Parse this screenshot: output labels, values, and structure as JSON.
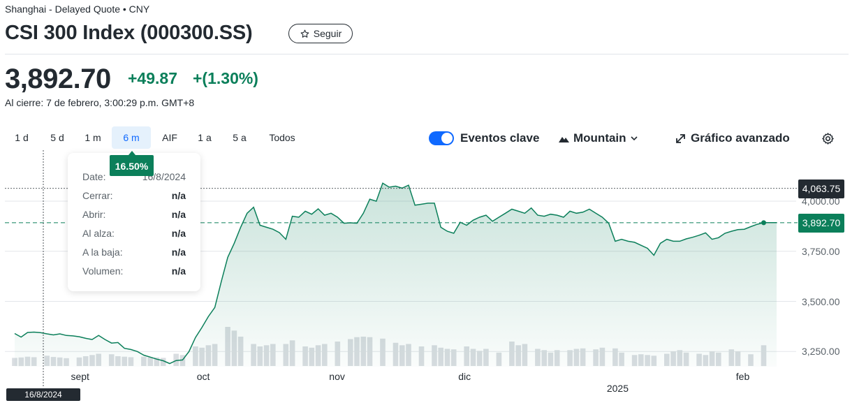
{
  "header": {
    "exchange_line": "Shanghai - Delayed Quote • CNY",
    "title": "CSI 300 Index (000300.SS)",
    "follow_label": "Seguir"
  },
  "quote": {
    "price": "3,892.70",
    "change": "+49.87",
    "change_percent": "+(1.30%)",
    "close_time": "Al cierre: 7 de febrero, 3:00:29 p.m. GMT+8"
  },
  "ranges": [
    {
      "label": "1 d",
      "active": false
    },
    {
      "label": "5 d",
      "active": false
    },
    {
      "label": "1 m",
      "active": false
    },
    {
      "label": "6 m",
      "active": true
    },
    {
      "label": "AIF",
      "active": false
    },
    {
      "label": "1 a",
      "active": false
    },
    {
      "label": "5 a",
      "active": false
    },
    {
      "label": "Todos",
      "active": false
    }
  ],
  "toolbar": {
    "events_label": "Eventos clave",
    "events_on": true,
    "chart_type_label": "Mountain",
    "advanced_label": "Gráfico avanzado"
  },
  "tooltip": {
    "badge": "16.50%",
    "rows": [
      {
        "label": "Date:",
        "value": "16/8/2024"
      },
      {
        "label": "Cerrar:",
        "value": "n/a"
      },
      {
        "label": "Abrir:",
        "value": "n/a"
      },
      {
        "label": "Al alza:",
        "value": "n/a"
      },
      {
        "label": "A la baja:",
        "value": "n/a"
      },
      {
        "label": "Volumen:",
        "value": "n/a"
      }
    ]
  },
  "crosshair_date": "16/8/2024",
  "colors": {
    "accent_green": "#0b7f5a",
    "tab_active_bg": "#e5f1fc",
    "tab_active_text": "#0f69ff",
    "hover_tag": "#232a31",
    "volume_bar": "#d9dde1"
  },
  "chart_data": {
    "type": "area",
    "y_ticks": [
      "3,250.00",
      "3,500.00",
      "3,750.00",
      "4,000.00"
    ],
    "y_tick_values": [
      3250,
      3500,
      3750,
      4000
    ],
    "ylim": [
      3150,
      4150
    ],
    "hover_level": {
      "label": "4,063.75",
      "value": 4063.75
    },
    "last_price": {
      "label": "3,892.70",
      "value": 3892.7
    },
    "x_labels": [
      {
        "label": "sept",
        "t": 10
      },
      {
        "label": "oct",
        "t": 29.5
      },
      {
        "label": "nov",
        "t": 50
      },
      {
        "label": "dic",
        "t": 70
      },
      {
        "label": "2025",
        "t": 93,
        "row": 2
      },
      {
        "label": "feb",
        "t": 113
      }
    ],
    "t_range": [
      0,
      118
    ],
    "x": [
      0,
      1,
      2,
      3,
      4,
      5,
      6,
      7,
      8,
      9,
      10,
      11,
      12,
      13,
      14,
      15,
      16,
      17,
      18,
      19,
      20,
      21,
      22,
      23,
      24,
      25,
      26,
      27,
      28,
      29,
      30,
      31,
      32,
      33,
      34,
      35,
      36,
      37,
      38,
      39,
      40,
      41,
      42,
      43,
      44,
      45,
      46,
      47,
      48,
      49,
      50,
      51,
      52,
      53,
      54,
      55,
      56,
      57,
      58,
      59,
      60,
      61,
      62,
      63,
      64,
      65,
      66,
      67,
      68,
      69,
      70,
      71,
      72,
      73,
      74,
      75,
      76,
      77,
      78,
      79,
      80,
      81,
      82,
      83,
      84,
      85,
      86,
      87,
      88,
      89,
      90,
      91,
      92,
      93,
      94,
      95,
      96,
      97,
      98,
      99,
      100,
      101,
      102,
      103,
      104,
      105,
      106,
      107,
      108,
      109,
      110,
      111,
      112,
      113,
      114,
      115,
      116,
      117,
      118
    ],
    "series": [
      {
        "values": [
          3340,
          3322,
          3345,
          3347,
          3344,
          3338,
          3333,
          3338,
          3330,
          3328,
          3324,
          3316,
          3310,
          3330,
          3310,
          3292,
          3295,
          3266,
          3260,
          3250,
          3232,
          3222,
          3212,
          3204,
          3190,
          3205,
          3208,
          3250,
          3320,
          3370,
          3425,
          3470,
          3600,
          3720,
          3790,
          3870,
          3940,
          3970,
          3880,
          3870,
          3860,
          3843,
          3810,
          3925,
          3920,
          3950,
          3935,
          3962,
          3930,
          3940,
          3920,
          3890,
          3892,
          3890,
          3940,
          4010,
          4000,
          4090,
          4070,
          4075,
          4065,
          4080,
          3980,
          3985,
          3990,
          3990,
          3870,
          3850,
          3840,
          3895,
          3880,
          3905,
          3920,
          3930,
          3900,
          3920,
          3940,
          3960,
          3950,
          3940,
          3966,
          3930,
          3925,
          3935,
          3930,
          3920,
          3950,
          3940,
          3945,
          3960,
          3940,
          3920,
          3890,
          3800,
          3810,
          3800,
          3795,
          3780,
          3765,
          3730,
          3790,
          3810,
          3800,
          3800,
          3812,
          3820,
          3830,
          3842,
          3810,
          3818,
          3840,
          3850,
          3858,
          3860,
          3873,
          3885,
          3892.7,
          3892.7,
          3892.7
        ],
        "volume_rel": [
          0.33,
          0.35,
          0.38,
          0.36,
          0.0,
          0.42,
          0.37,
          0.35,
          0.32,
          0.0,
          0.35,
          0.4,
          0.45,
          0.5,
          0.0,
          0.48,
          0.4,
          0.38,
          0.36,
          0.0,
          0.38,
          0.36,
          0.35,
          0.33,
          0.0,
          0.5,
          0.45,
          0.0,
          0.8,
          0.75,
          0.85,
          0.9,
          0.0,
          1.6,
          1.45,
          1.2,
          0.0,
          0.9,
          0.8,
          0.85,
          0.9,
          0.0,
          0.9,
          1.05,
          0.0,
          0.8,
          0.75,
          0.85,
          0.9,
          0.0,
          1.0,
          0.0,
          1.1,
          1.18,
          1.2,
          1.18,
          0.0,
          1.12,
          0.0,
          0.95,
          0.85,
          0.9,
          0.0,
          0.8,
          0.0,
          0.85,
          0.75,
          0.7,
          0.68,
          0.0,
          0.8,
          0.7,
          0.62,
          0.7,
          0.0,
          0.55,
          0.0,
          1.0,
          0.85,
          0.9,
          0.0,
          0.7,
          0.65,
          0.55,
          0.65,
          0.0,
          0.65,
          0.7,
          0.72,
          0.0,
          0.68,
          0.75,
          0.0,
          0.72,
          0.55,
          0.0,
          0.45,
          0.48,
          0.45,
          0.42,
          0.0,
          0.5,
          0.6,
          0.65,
          0.55,
          0.0,
          0.5,
          0.45,
          0.6,
          0.55,
          0.0,
          0.68,
          0.6,
          0.0,
          0.48,
          0.0,
          0.85,
          0.0,
          0.0
        ]
      }
    ]
  }
}
